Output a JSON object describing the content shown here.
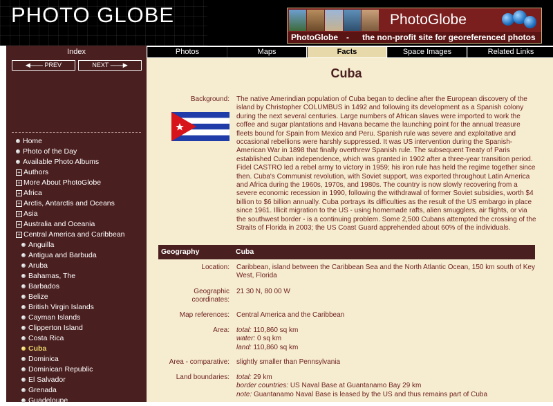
{
  "header": {
    "logo": "PHOTO GLOBE",
    "banner_title": "PhotoGlobe",
    "banner_name": "PhotoGlobe",
    "banner_dash": "-",
    "banner_desc": "the non-profit site for georeferenced photos",
    "colors": {
      "banner_bg": "#7a1e1e",
      "sidebar_bg": "#4a1f20",
      "content_bg": "#f6ecd0"
    }
  },
  "sidebar": {
    "index_label": "Index",
    "prev_label": "PREV",
    "next_label": "NEXT",
    "menu": [
      {
        "label": "Home",
        "type": "bullet",
        "level": 0
      },
      {
        "label": "Photo of the Day",
        "type": "bullet",
        "level": 0
      },
      {
        "label": "Available Photo Albums",
        "type": "bullet",
        "level": 0
      },
      {
        "label": "Authors",
        "type": "plus",
        "level": 0
      },
      {
        "label": "More About PhotoGlobe",
        "type": "plus",
        "level": 0
      },
      {
        "label": "Africa",
        "type": "plus",
        "level": 0
      },
      {
        "label": "Arctis, Antarctis and Oceans",
        "type": "plus",
        "level": 0
      },
      {
        "label": "Asia",
        "type": "plus",
        "level": 0
      },
      {
        "label": "Australia and Oceania",
        "type": "plus",
        "level": 0
      },
      {
        "label": "Central America and Caribbean",
        "type": "plus",
        "level": 0
      },
      {
        "label": "Anguilla",
        "type": "bullet",
        "level": 1
      },
      {
        "label": "Antigua and Barbuda",
        "type": "bullet",
        "level": 1
      },
      {
        "label": "Aruba",
        "type": "bullet",
        "level": 1
      },
      {
        "label": "Bahamas, The",
        "type": "bullet",
        "level": 1
      },
      {
        "label": "Barbados",
        "type": "bullet",
        "level": 1
      },
      {
        "label": "Belize",
        "type": "bullet",
        "level": 1
      },
      {
        "label": "British Virgin Islands",
        "type": "bullet",
        "level": 1
      },
      {
        "label": "Cayman Islands",
        "type": "bullet",
        "level": 1
      },
      {
        "label": "Clipperton Island",
        "type": "bullet",
        "level": 1
      },
      {
        "label": "Costa Rica",
        "type": "bullet",
        "level": 1
      },
      {
        "label": "Cuba",
        "type": "bullet",
        "level": 1,
        "active": true
      },
      {
        "label": "Dominica",
        "type": "bullet",
        "level": 1
      },
      {
        "label": "Dominican Republic",
        "type": "bullet",
        "level": 1
      },
      {
        "label": "El Salvador",
        "type": "bullet",
        "level": 1
      },
      {
        "label": "Grenada",
        "type": "bullet",
        "level": 1
      },
      {
        "label": "Guadeloupe",
        "type": "bullet",
        "level": 1
      }
    ]
  },
  "tabs": [
    {
      "label": "Photos",
      "active": false
    },
    {
      "label": "Maps",
      "active": false
    },
    {
      "label": "Facts",
      "active": true
    },
    {
      "label": "Space Images",
      "active": false
    },
    {
      "label": "Related Links",
      "active": false
    }
  ],
  "content": {
    "title": "Cuba",
    "background_label": "Background:",
    "background_text": "The native Amerindian population of Cuba began to decline after the European discovery of the island by Christopher COLUMBUS in 1492 and following its development as a Spanish colony during the next several centuries. Large numbers of African slaves were imported to work the coffee and sugar plantations and Havana became the launching point for the annual treasure fleets bound for Spain from Mexico and Peru. Spanish rule was severe and exploitative and occasional rebellions were harshly suppressed. It was US intervention during the Spanish-American War in 1898 that finally overthrew Spanish rule. The subsequent Treaty of Paris established Cuban independence, which was granted in 1902 after a three-year transition period. Fidel CASTRO led a rebel army to victory in 1959; his iron rule has held the regime together since then. Cuba's Communist revolution, with Soviet support, was exported throughout Latin America and Africa during the 1960s, 1970s, and 1980s. The country is now slowly recovering from a severe economic recession in 1990, following the withdrawal of former Soviet subsidies, worth $4 billion to $6 billion annually. Cuba portrays its difficulties as the result of the US embargo in place since 1961. Illicit migration to the US - using homemade rafts, alien smugglers, air flights, or via the southwest border - is a continuing problem. Some 2,500 Cubans attempted the crossing of the Straits of Florida in 2003; the US Coast Guard apprehended about 60% of the individuals.",
    "geo_heading": "Geography",
    "geo_country": "Cuba",
    "location_label": "Location:",
    "location_value": "Caribbean, island between the Caribbean Sea and the North Atlantic Ocean, 150 km south of Key West, Florida",
    "coords_label_1": "Geographic",
    "coords_label_2": "coordinates:",
    "coords_value": "21 30 N, 80 00 W",
    "mapref_label": "Map references:",
    "mapref_value": "Central America and the Caribbean",
    "area_label": "Area:",
    "area_total_k": "total:",
    "area_total_v": "110,860 sq km",
    "area_water_k": "water:",
    "area_water_v": "0 sq km",
    "area_land_k": "land:",
    "area_land_v": "110,860 sq km",
    "areacomp_label": "Area - comparative:",
    "areacomp_value": "slightly smaller than Pennsylvania",
    "landb_label": "Land boundaries:",
    "landb_total_k": "total:",
    "landb_total_v": "29 km",
    "landb_border_k": "border countries:",
    "landb_border_v": "US Naval Base at Guantanamo Bay 29 km",
    "landb_note_k": "note:",
    "landb_note_v": "Guantanamo Naval Base is leased by the US and thus remains part of Cuba"
  }
}
